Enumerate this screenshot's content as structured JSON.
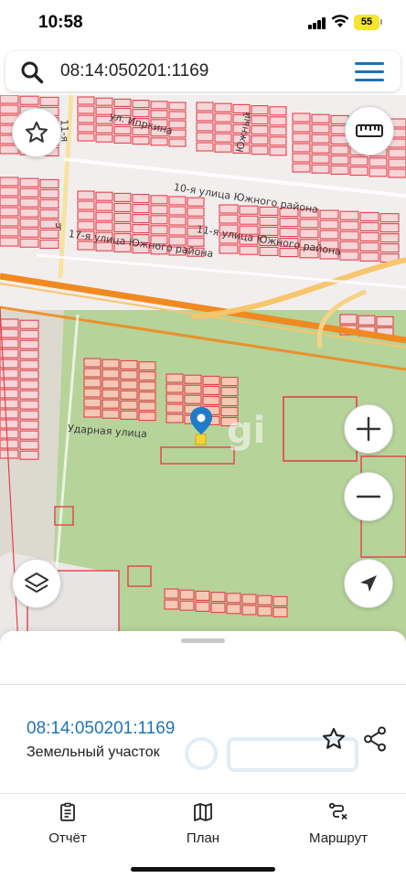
{
  "status_bar": {
    "time": "10:58",
    "battery": "55"
  },
  "search": {
    "query": "08:14:050201:1169"
  },
  "map": {
    "street_labels": [
      "ул. Ипркина",
      "11-я",
      "Южный",
      "10-я улица Южного района",
      "11-я улица Южного района",
      "17-я улица Южного района",
      "Ч",
      "Ударная улица"
    ],
    "watermark": "gi"
  },
  "plot": {
    "number": "08:14:050201:1169",
    "type": "Земельный участок"
  },
  "tabs": [
    {
      "label": "Отчёт",
      "icon": "report-icon"
    },
    {
      "label": "План",
      "icon": "map-plan-icon"
    },
    {
      "label": "Маршрут",
      "icon": "route-icon"
    }
  ],
  "colors": {
    "accent": "#1b72b8",
    "link": "#1d74b6",
    "map_field": "#b6d39a",
    "parcel_outline": "#e5404a",
    "road": "#f08a20",
    "battery": "#f5e52b"
  }
}
